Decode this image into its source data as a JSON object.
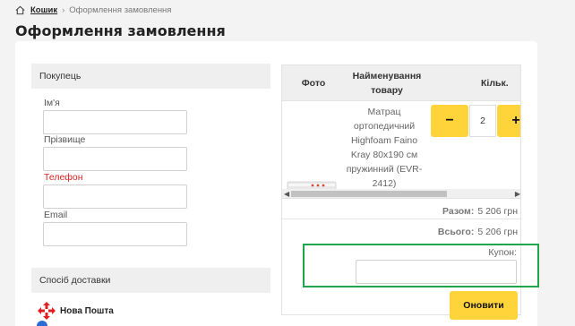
{
  "breadcrumb": {
    "home_icon": "home-icon",
    "cart": "Кошик",
    "separator": "›",
    "current": "Оформлення замовлення"
  },
  "page_title": "Оформлення замовлення",
  "buyer": {
    "heading": "Покупець",
    "fields": [
      {
        "label": "Ім'я",
        "value": ""
      },
      {
        "label": "Прізвище",
        "value": ""
      },
      {
        "label": "Телефон",
        "value": ""
      },
      {
        "label": "Email",
        "value": ""
      }
    ]
  },
  "delivery": {
    "heading": "Спосіб доставки",
    "options": [
      {
        "name": "Нова Пошта",
        "icon": "nova-poshta-logo-icon"
      }
    ]
  },
  "cart_table": {
    "columns": [
      "Фото",
      "Найменування товару",
      "Кільк."
    ],
    "items": [
      {
        "name": "Матрац ортопедичний Highfoam Faino Kray 80x190 см пружинний (EVR-2412)",
        "quantity": "2",
        "minus_label": "−",
        "plus_label": "+"
      }
    ],
    "subtotal_label": "Разом:",
    "subtotal_value": "5 206 грн",
    "total_label": "Всього:",
    "total_value": "5 206 грн",
    "coupon_label": "Купон:",
    "coupon_value": ""
  },
  "update_button": "Оновити",
  "colors": {
    "accent": "#ffd43b",
    "required": "#dd2222",
    "highlight": "#1fa64a",
    "nova_poshta": "#e02020"
  }
}
